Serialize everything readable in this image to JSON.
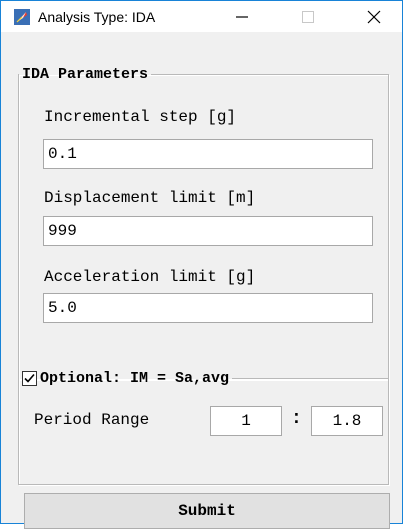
{
  "window": {
    "title": "Analysis Type: IDA",
    "app_icon": "feather-app-icon",
    "controls": {
      "minimize": "—",
      "maximize": "□",
      "close": "✕"
    }
  },
  "ida_parameters": {
    "legend": "IDA Parameters",
    "fields": [
      {
        "label": "Incremental step [g]",
        "value": "0.1"
      },
      {
        "label": "Displacement limit [m]",
        "value": "999"
      },
      {
        "label": "Acceleration limit [g]",
        "value": "5.0"
      }
    ]
  },
  "optional": {
    "legend": "Optional: IM = Sa,avg",
    "checked": true,
    "period_range_label": "Period Range",
    "period_from": "1",
    "separator": ":",
    "period_to": "1.8"
  },
  "submit_label": "Submit",
  "colors": {
    "window_border": "#1883d7",
    "background": "#f0f0f0",
    "button": "#e1e1e1"
  }
}
